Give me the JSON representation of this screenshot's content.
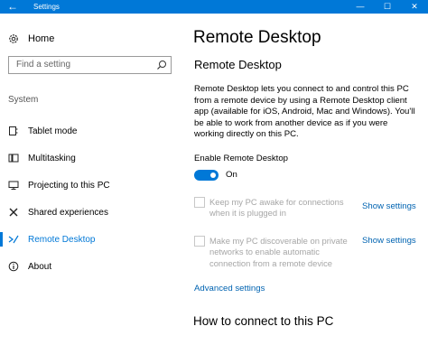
{
  "window": {
    "title": "Settings",
    "back_glyph": "←",
    "min_glyph": "—",
    "max_glyph": "☐",
    "close_glyph": "✕",
    "accent": "#0078d7"
  },
  "sidebar": {
    "home_label": "Home",
    "search_placeholder": "Find a setting",
    "section_label": "System",
    "items": [
      {
        "label": "Tablet mode",
        "icon": "tablet-mode-icon"
      },
      {
        "label": "Multitasking",
        "icon": "multitasking-icon"
      },
      {
        "label": "Projecting to this PC",
        "icon": "projecting-icon"
      },
      {
        "label": "Shared experiences",
        "icon": "shared-experiences-icon"
      },
      {
        "label": "Remote Desktop",
        "icon": "remote-desktop-icon",
        "active": true
      },
      {
        "label": "About",
        "icon": "about-icon"
      }
    ]
  },
  "main": {
    "page_title": "Remote Desktop",
    "section_title": "Remote Desktop",
    "description": "Remote Desktop lets you connect to and control this PC from a remote device by using a Remote Desktop client app (available for iOS, Android, Mac and Windows). You'll be able to work from another device as if you were working directly on this PC.",
    "enable_label": "Enable Remote Desktop",
    "toggle_state": "On",
    "toggle_on": true,
    "option_awake": "Keep my PC awake for connections when it is plugged in",
    "option_discoverable": "Make my PC discoverable on private networks to enable automatic connection from a remote device",
    "show_settings": "Show settings",
    "advanced_settings": "Advanced settings",
    "how_to_connect": "How to connect to this PC",
    "link_color": "#0063b1"
  }
}
